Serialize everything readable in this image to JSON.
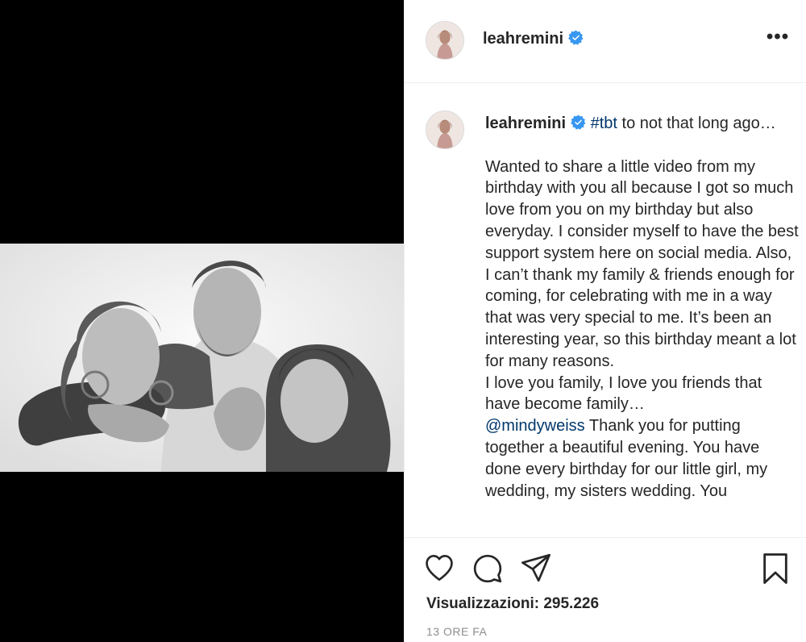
{
  "post": {
    "username": "leahremini",
    "verified": true,
    "more_icon": "more-horizontal-icon"
  },
  "caption": {
    "username": "leahremini",
    "hashtag": "#tbt",
    "text_after_hashtag": " to not that long ago…",
    "paragraph_1": "Wanted to share a little video from my birthday with you all because I got so much love from you on my birthday but also everyday. I consider myself to have the best support system here on social media. Also, I can’t thank my family & friends enough for coming, for celebrating with me in a way that was very special to me. It’s been an interesting year, so this birthday meant a lot for many reasons.",
    "paragraph_2": "I love you family, I love you friends that have become family…",
    "mention": "@mindyweiss",
    "text_after_mention": " Thank you for putting together a beautiful evening. You have done every birthday for our little girl, my wedding, my sisters wedding. You"
  },
  "actions": {
    "like_icon": "heart-icon",
    "comment_icon": "comment-bubble-icon",
    "share_icon": "paper-plane-icon",
    "save_icon": "bookmark-icon"
  },
  "stats": {
    "views": "Visualizzazioni: 295.226",
    "timestamp": "13 ORE FA"
  },
  "colors": {
    "link": "#00376b",
    "verified_badge": "#3897f0",
    "text": "#262626",
    "muted": "#8e8e8e",
    "border": "#efefef"
  }
}
